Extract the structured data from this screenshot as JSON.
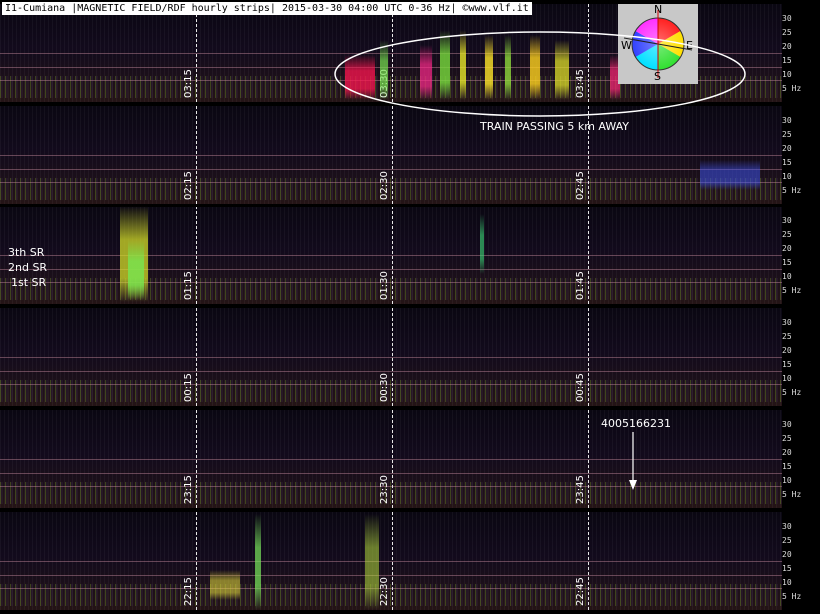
{
  "title": "I1-Cumiana |MAGNETIC FIELD/RDF hourly strips| 2015-03-30 04:00 UTC 0-36 Hz| ©www.vlf.it",
  "strips": [
    {
      "times": [
        "03:15",
        "03:30",
        "03:45"
      ]
    },
    {
      "times": [
        "02:15",
        "02:30",
        "02:45"
      ]
    },
    {
      "times": [
        "01:15",
        "01:30",
        "01:45"
      ]
    },
    {
      "times": [
        "00:15",
        "00:30",
        "00:45"
      ]
    },
    {
      "times": [
        "23:15",
        "23:30",
        "23:45"
      ]
    },
    {
      "times": [
        "22:15",
        "22:30",
        "22:45"
      ]
    }
  ],
  "axis_ticks": [
    "30",
    "25",
    "20",
    "15",
    "10",
    "5 Hz"
  ],
  "annotations": {
    "train": "TRAIN PASSING 5 km AWAY",
    "sr3": "3th SR",
    "sr2": "2nd SR",
    "sr1": "1st SR",
    "number": "4005166231"
  },
  "compass": {
    "n": "N",
    "s": "S",
    "e": "E",
    "w": "W"
  }
}
